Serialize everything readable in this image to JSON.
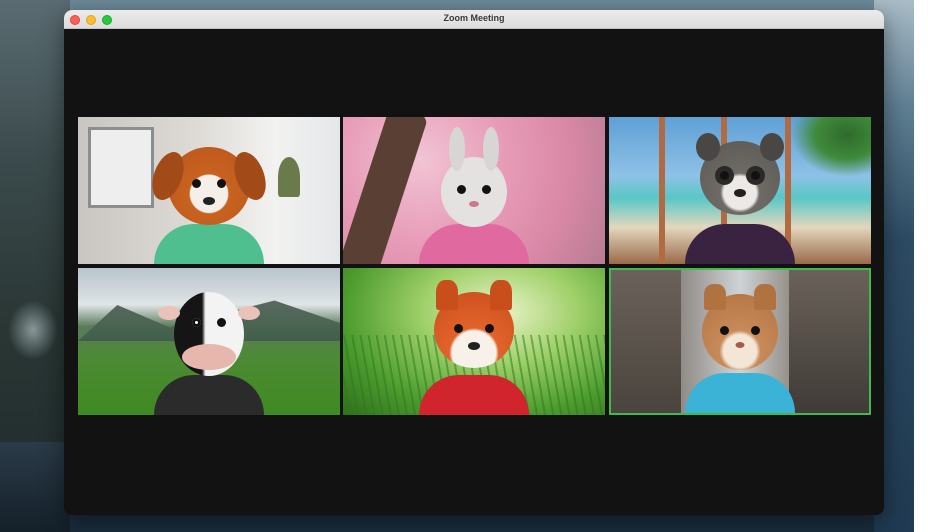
{
  "window": {
    "title": "Zoom Meeting",
    "controls": [
      "close",
      "minimize",
      "maximize"
    ]
  },
  "participants": [
    {
      "avatar": "dog",
      "shirt_color": "#4fbf8f"
    },
    {
      "avatar": "rabbit",
      "shirt_color": "#e06aa0"
    },
    {
      "avatar": "raccoon",
      "shirt_color": "#3a2340"
    },
    {
      "avatar": "cow",
      "shirt_color": "#2b2b2b"
    },
    {
      "avatar": "fox",
      "shirt_color": "#d0252d"
    },
    {
      "avatar": "cat",
      "shirt_color": "#3ab3d6",
      "active_speaker": true
    }
  ],
  "colors": {
    "active_speaker_border": "#3fb950",
    "window_background": "#121212"
  }
}
